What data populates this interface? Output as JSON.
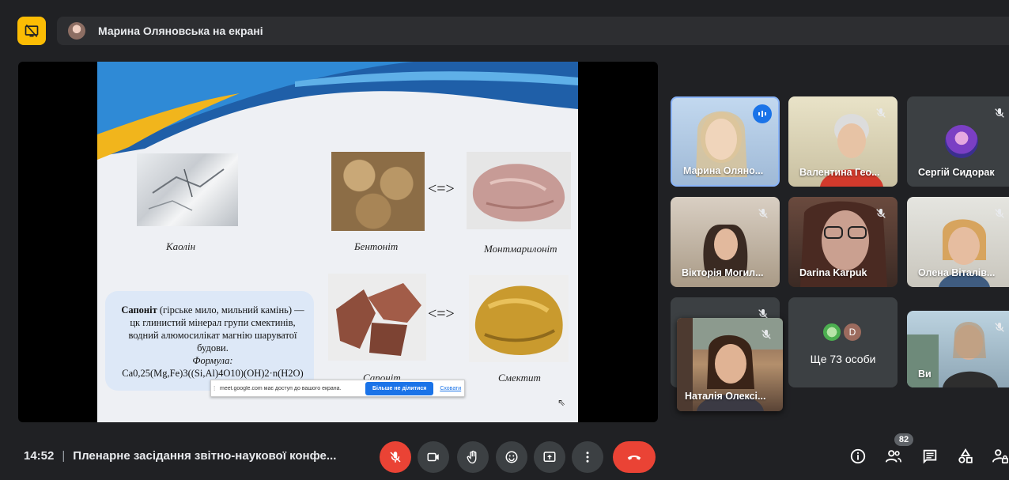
{
  "presenting": {
    "label": "Марина Оляновська на екрані"
  },
  "slide": {
    "labels": {
      "kaolin": "Каолін",
      "bentonite": "Бентоніт",
      "montmorillonite": "Монтмарилоніт",
      "saponite": "Сапоніт",
      "smectite": "Смектит"
    },
    "arrow_top": "<=>",
    "arrow_bottom": "<=>",
    "info": {
      "title": "Сапоніт",
      "body": " (гірське мило, мильний камінь) — цк глинистий мінерал групи смектинів, водний алюмосилікат магнію шаруватої будови.",
      "formula_label": "Формула:",
      "formula": "Ca0,25(Mg,Fe)3((Si,Al)4O10)(OH)2·n(H2O)"
    },
    "share_notice": {
      "message": "meet.google.com має доступ до вашого екрана.",
      "stop_button": "Більше не ділитися",
      "hide_link": "Сховати"
    }
  },
  "participants": [
    {
      "name": "Марина Оляно...",
      "speaking": true
    },
    {
      "name": "Валентина Гео...",
      "muted": true
    },
    {
      "name": "Сергій Сидорак",
      "muted": true
    },
    {
      "name": "Вікторія Могил...",
      "muted": true
    },
    {
      "name": "Darina Karpuk",
      "muted": true
    },
    {
      "name": "Олена Віталів...",
      "muted": true
    },
    {
      "name": "",
      "muted": true
    },
    {
      "name": "Ще 73 особи",
      "avatar_letter": "D"
    },
    {
      "name": "Ви",
      "muted": true
    }
  ],
  "floating_tile": {
    "name": "Наталія Олексі..."
  },
  "bottom": {
    "time": "14:52",
    "separator": "|",
    "meeting_title": "Пленарне засідання звітно-наукової конфе...",
    "people_count": "82"
  },
  "colors": {
    "background": "#202124",
    "accent_yellow": "#fbbc04",
    "danger_red": "#ea4335",
    "active_blue": "#8ab4f8",
    "button_gray": "#3c4043"
  }
}
